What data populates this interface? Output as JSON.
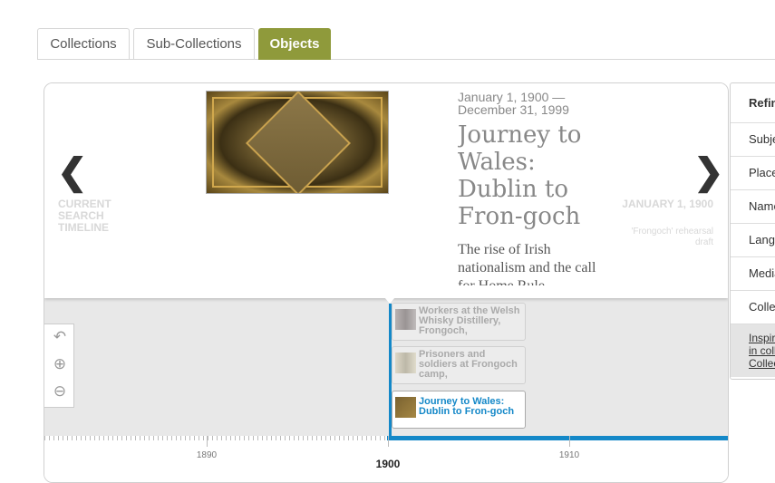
{
  "tabs": [
    {
      "label": "Collections",
      "active": false
    },
    {
      "label": "Sub-Collections",
      "active": false
    },
    {
      "label": "Objects",
      "active": true
    }
  ],
  "colors": {
    "accent_tab": "#8f9a3b",
    "timeline_blue": "#1488c8"
  },
  "hero": {
    "prev_label": "CURRENT SEARCH TIMELINE",
    "next_date": "JANUARY 1, 1900",
    "next_title": "'Frongoch' rehearsal draft",
    "date_range": "January 1, 1900 — December 31, 1999",
    "title": "Journey to Wales: Dublin to Fron-goch",
    "description": "The rise of Irish nationalism and the call for Home Rule"
  },
  "timeline": {
    "controls": {
      "back": "back-arrow-icon",
      "zoom_in": "zoom-in-icon",
      "zoom_out": "zoom-out-icon"
    },
    "events": [
      {
        "label": "Workers at the Welsh Whisky Distillery, Frongoch,",
        "selected": false
      },
      {
        "label": "Prisoners and soldiers at Frongoch camp,",
        "selected": false
      },
      {
        "label": "Journey to Wales: Dublin to Fron-goch",
        "selected": true
      }
    ],
    "years": {
      "y1890": "1890",
      "y1900": "1900",
      "y1910": "1910"
    }
  },
  "refine": {
    "heading": "Refine",
    "items": [
      "Subject",
      "Place",
      "Name",
      "Language",
      "Media",
      "Collection"
    ],
    "link": [
      "Inspired",
      "in collection",
      "Collections"
    ]
  }
}
